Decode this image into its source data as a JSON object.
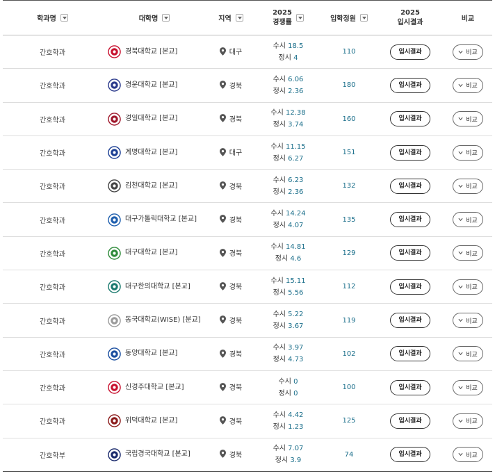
{
  "header": {
    "dept": "학과명",
    "univ": "대학명",
    "region": "지역",
    "rate_year": "2025",
    "rate_label": "경쟁률",
    "quota": "입학정원",
    "result_year": "2025",
    "result_label": "입시결과",
    "compare": "비교"
  },
  "labels": {
    "susi": "수시",
    "jeongsi": "정시",
    "result_button": "입시결과",
    "compare_button": "비교"
  },
  "rows": [
    {
      "dept": "간호학과",
      "univ": "경북대학교 [본교]",
      "logo_color": "#c8102e",
      "region": "대구",
      "susi": "18.5",
      "jeongsi": "4",
      "quota": "110"
    },
    {
      "dept": "간호학과",
      "univ": "경운대학교 [본교]",
      "logo_color": "#2b3a8c",
      "region": "경북",
      "susi": "6.06",
      "jeongsi": "2.36",
      "quota": "180"
    },
    {
      "dept": "간호학과",
      "univ": "경일대학교 [본교]",
      "logo_color": "#a0182c",
      "region": "경북",
      "susi": "12.38",
      "jeongsi": "3.74",
      "quota": "160"
    },
    {
      "dept": "간호학과",
      "univ": "계명대학교 [본교]",
      "logo_color": "#1c3f94",
      "region": "대구",
      "susi": "11.15",
      "jeongsi": "6.27",
      "quota": "151"
    },
    {
      "dept": "간호학과",
      "univ": "김천대학교 [본교]",
      "logo_color": "#444444",
      "region": "경북",
      "susi": "6.23",
      "jeongsi": "2.36",
      "quota": "132"
    },
    {
      "dept": "간호학과",
      "univ": "대구가톨릭대학교 [본교]",
      "logo_color": "#1f5fae",
      "region": "경북",
      "susi": "14.24",
      "jeongsi": "4.07",
      "quota": "135"
    },
    {
      "dept": "간호학과",
      "univ": "대구대학교 [본교]",
      "logo_color": "#2e8b3a",
      "region": "경북",
      "susi": "14.81",
      "jeongsi": "4.6",
      "quota": "129"
    },
    {
      "dept": "간호학과",
      "univ": "대구한의대학교 [본교]",
      "logo_color": "#1a7a6e",
      "region": "경북",
      "susi": "15.11",
      "jeongsi": "5.56",
      "quota": "112"
    },
    {
      "dept": "간호학과",
      "univ": "동국대학교(WISE) [분교]",
      "logo_color": "#9a9a9a",
      "region": "경북",
      "susi": "5.22",
      "jeongsi": "3.67",
      "quota": "119"
    },
    {
      "dept": "간호학과",
      "univ": "동양대학교 [본교]",
      "logo_color": "#1b4fa0",
      "region": "경북",
      "susi": "3.97",
      "jeongsi": "4.73",
      "quota": "102"
    },
    {
      "dept": "간호학과",
      "univ": "신경주대학교 [본교]",
      "logo_color": "#c8102e",
      "region": "경북",
      "susi": "0",
      "jeongsi": "0",
      "quota": "100"
    },
    {
      "dept": "간호학과",
      "univ": "위덕대학교 [본교]",
      "logo_color": "#8b1a1a",
      "region": "경북",
      "susi": "4.42",
      "jeongsi": "1.23",
      "quota": "125"
    },
    {
      "dept": "간호학부",
      "univ": "국립경국대학교 [본교]",
      "logo_color": "#1a2a6c",
      "region": "경북",
      "susi": "7.07",
      "jeongsi": "3.9",
      "quota": "74"
    }
  ]
}
